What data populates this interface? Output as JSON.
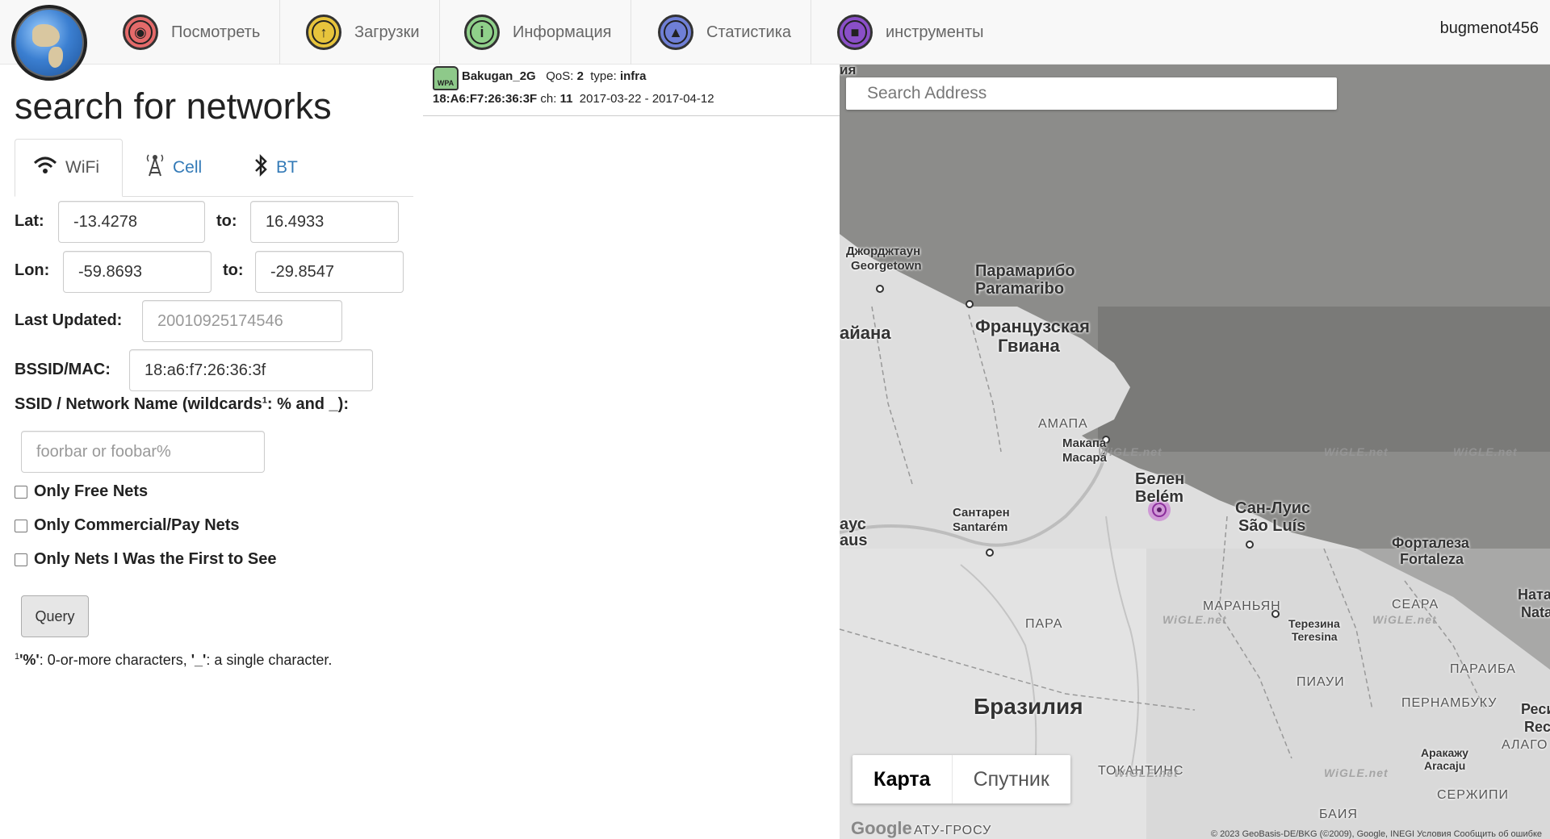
{
  "nav": {
    "items": [
      {
        "label": "Посмотреть",
        "icon": "view-icon",
        "color": "#e46a6a"
      },
      {
        "label": "Загрузки",
        "icon": "upload-icon",
        "color": "#e7c43c"
      },
      {
        "label": "Информация",
        "icon": "info-icon",
        "color": "#8fd08a"
      },
      {
        "label": "Статистика",
        "icon": "stats-icon",
        "color": "#6f7fd6"
      },
      {
        "label": "инструменты",
        "icon": "tools-icon",
        "color": "#8a4fc8"
      }
    ],
    "user": "bugmenot456"
  },
  "search": {
    "title": "search for networks",
    "tabs": [
      {
        "label": "WiFi",
        "icon": "wifi-icon",
        "active": true
      },
      {
        "label": "Cell",
        "icon": "cell-tower-icon",
        "active": false
      },
      {
        "label": "BT",
        "icon": "bluetooth-icon",
        "active": false
      }
    ],
    "lat_label": "Lat:",
    "lat_from": "-13.4278",
    "lat_to_label": "to:",
    "lat_to": "16.4933",
    "lon_label": "Lon:",
    "lon_from": "-59.8693",
    "lon_to_label": "to:",
    "lon_to": "-29.8547",
    "last_updated_label": "Last Updated:",
    "last_updated_placeholder": "20010925174546",
    "bssid_label": "BSSID/MAC:",
    "bssid_value": "18:a6:f7:26:36:3f",
    "ssid_label_pre": "SSID / Network Name (wildcards",
    "ssid_label_sup": "1",
    "ssid_label_post": ": % and _):",
    "ssid_placeholder": "foorbar or foobar%",
    "checkboxes": [
      {
        "label": "Only Free Nets",
        "checked": false
      },
      {
        "label": "Only Commercial/Pay Nets",
        "checked": false
      },
      {
        "label": "Only Nets I Was the First to See",
        "checked": false
      }
    ],
    "query_button": "Query",
    "footnote_sup": "1",
    "footnote_pct": "'%'",
    "footnote_mid": ": 0-or-more characters, ",
    "footnote_us": "'_'",
    "footnote_end": ": a single character."
  },
  "results": [
    {
      "ssid": "Bakugan_2G",
      "qos_label": "QoS:",
      "qos": "2",
      "type_label": "type:",
      "type": "infra",
      "bssid": "18:A6:F7:26:36:3F",
      "ch_label": "ch:",
      "channel": "11",
      "dates": "2017-03-22 - 2017-04-12",
      "security_badge": "WPA"
    }
  ],
  "map": {
    "search_placeholder": "Search Address",
    "map_type_map": "Карта",
    "map_type_satellite": "Спутник",
    "labels": {
      "top_fragment": "ия",
      "georgetown_ru": "Джорджтаун",
      "georgetown": "Georgetown",
      "paramaribo_ru": "Парамарибо",
      "paramaribo": "Paramaribo",
      "french_guiana_ru1": "Французская",
      "french_guiana_ru2": "Гвиана",
      "guyana": "айана",
      "amapa": "АМАПА",
      "macapa_ru": "Макапа",
      "macapa": "Macapá",
      "belem_ru": "Белен",
      "belem": "Belém",
      "santarem_ru": "Сантарен",
      "santarem": "Santarém",
      "manaus_ru": "аус",
      "manaus": "aus",
      "sao_luis_ru": "Сан-Луис",
      "sao_luis": "São Luís",
      "fortaleza_ru": "Форталеза",
      "fortaleza": "Fortaleza",
      "natal_ru": "Натал",
      "natal": "Natal",
      "maranhao": "МАРАНЬЯН",
      "ceara": "СЕАРА",
      "para": "ПАРА",
      "teresina_ru": "Терезина",
      "teresina": "Teresina",
      "piaui": "ПИАУИ",
      "paraiba": "ПАРАИБА",
      "pernambuco": "ПЕРНАМБУКУ",
      "recife_ru": "Ресиф",
      "recife": "Recif",
      "alagoas": "АЛАГО",
      "brazil": "Бразилия",
      "aracaju_ru": "Аракажу",
      "aracaju": "Aracaju",
      "tocantins": "ТОКАНТИНС",
      "sergipe": "СЕРЖИПИ",
      "bahia": "БАИЯ",
      "mato_grosso": "АТУ-ГРОСУ"
    },
    "watermark": "WiGLE.net",
    "google": "Google",
    "copyright": "© 2023 GeoBasis-DE/BKG (©2009), Google, INEGI  Условия  Сообщить об ошибке"
  }
}
